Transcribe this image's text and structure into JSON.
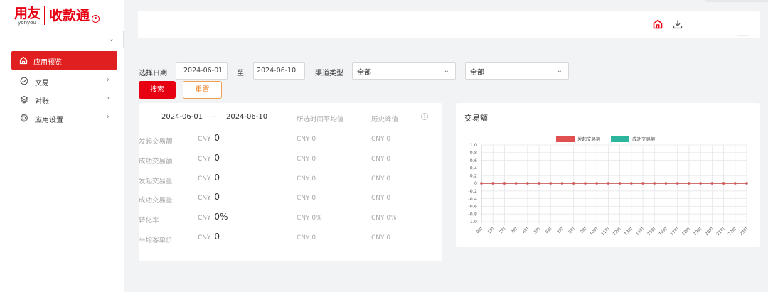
{
  "logo": {
    "brand_big": "用友",
    "brand_small": "yonyou",
    "app_name": "收款通"
  },
  "sidebar": {
    "menu": [
      {
        "label": "应用预览",
        "icon": "home-icon",
        "active": true,
        "has_arrow": false
      },
      {
        "label": "交易",
        "icon": "check-circle-icon",
        "active": false,
        "has_arrow": true
      },
      {
        "label": "对账",
        "icon": "layers-icon",
        "active": false,
        "has_arrow": true
      },
      {
        "label": "应用设置",
        "icon": "gear-icon",
        "active": false,
        "has_arrow": true
      }
    ]
  },
  "topbar": {
    "icons": [
      "home-icon",
      "download-icon"
    ]
  },
  "filters": {
    "date_label": "选择日期",
    "start_date": "2024-06-01",
    "to_label": "至",
    "end_date": "2024-06-10",
    "channel_label": "渠道类型",
    "channel_value": "全部",
    "second_select_value": "全部",
    "search_button": "搜索",
    "reset_button": "重置"
  },
  "stats": {
    "range_start": "2024-06-01",
    "range_sep": "—",
    "range_end": "2024-06-10",
    "col_avg": "所选时间平均值",
    "col_hist": "历史峰值",
    "rows": [
      {
        "label": "发起交易额",
        "currency": "CNY",
        "value": "0",
        "avg": "CNY 0",
        "hist": "CNY 0"
      },
      {
        "label": "成功交易额",
        "currency": "CNY",
        "value": "0",
        "avg": "CNY 0",
        "hist": "CNY 0"
      },
      {
        "label": "发起交易量",
        "currency": "CNY",
        "value": "0",
        "avg": "CNY 0",
        "hist": "CNY 0"
      },
      {
        "label": "成功交易量",
        "currency": "CNY",
        "value": "0",
        "avg": "CNY 0",
        "hist": "CNY 0"
      },
      {
        "label": "转化率",
        "currency": "CNY",
        "value": "0%",
        "avg": "CNY 0%",
        "hist": "CNY 0%"
      },
      {
        "label": "平均客单价",
        "currency": "CNY",
        "value": "0",
        "avg": "CNY 0",
        "hist": "CNY 0"
      }
    ]
  },
  "chart_data": {
    "type": "line",
    "title": "交易额",
    "legend_position": "top",
    "grid": true,
    "ylim": [
      -1.0,
      1.0
    ],
    "y_ticks": [
      "1.0",
      "0.8",
      "0.6",
      "0.4",
      "0.2",
      "0",
      "-0.2",
      "-0.4",
      "-0.6",
      "-0.8",
      "-1.0"
    ],
    "categories": [
      "0时",
      "1时",
      "2时",
      "3时",
      "4时",
      "5时",
      "6时",
      "7时",
      "8时",
      "9时",
      "10时",
      "11时",
      "12时",
      "13时",
      "14时",
      "15时",
      "16时",
      "17时",
      "18时",
      "19时",
      "20时",
      "21时",
      "22时",
      "23时"
    ],
    "series": [
      {
        "name": "发起交易额",
        "color": "#e05050",
        "values": [
          0,
          0,
          0,
          0,
          0,
          0,
          0,
          0,
          0,
          0,
          0,
          0,
          0,
          0,
          0,
          0,
          0,
          0,
          0,
          0,
          0,
          0,
          0,
          0
        ]
      },
      {
        "name": "成功交易额",
        "color": "#2bb59a",
        "values": [
          0,
          0,
          0,
          0,
          0,
          0,
          0,
          0,
          0,
          0,
          0,
          0,
          0,
          0,
          0,
          0,
          0,
          0,
          0,
          0,
          0,
          0,
          0,
          0
        ]
      }
    ]
  }
}
